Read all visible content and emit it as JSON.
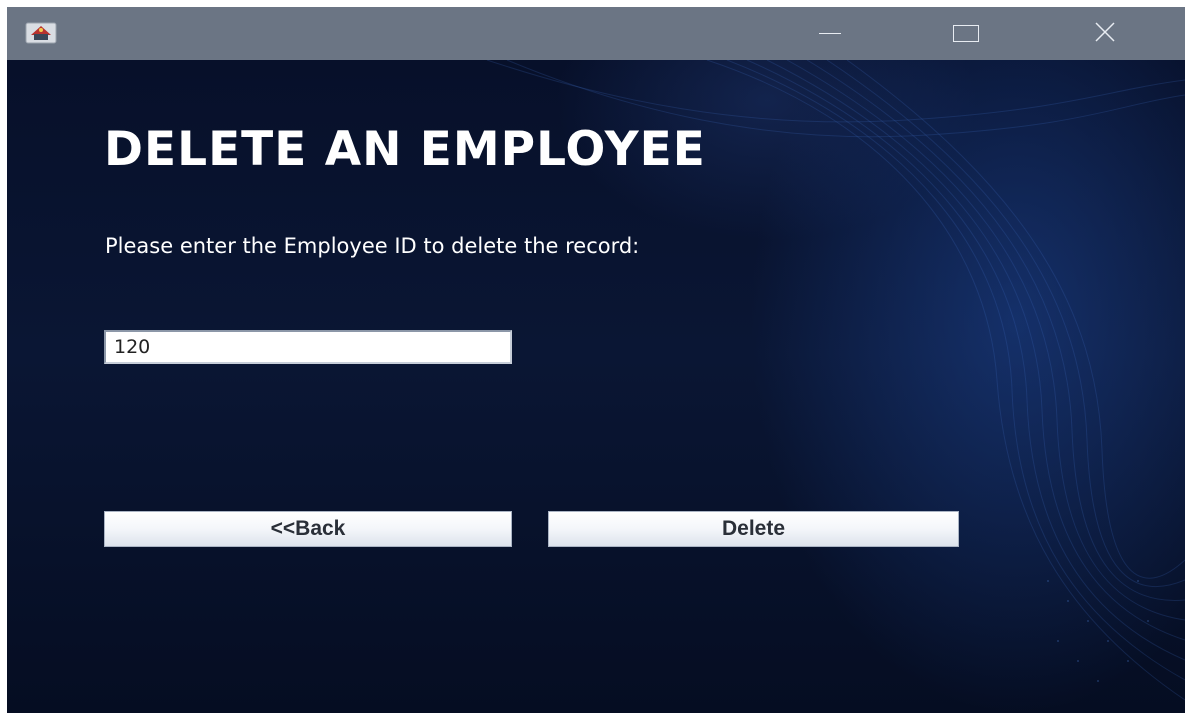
{
  "window": {
    "icon": "java-cup-icon",
    "controls": [
      "minimize-icon",
      "maximize-icon",
      "close-icon"
    ]
  },
  "form": {
    "title": "DELETE AN EMPLOYEE",
    "prompt": "Please enter the Employee ID to delete the record:",
    "employee_id_value": "120"
  },
  "buttons": {
    "back_label": "<<Back",
    "delete_label": "Delete"
  },
  "colors": {
    "titlebar": "#6b7584",
    "background": "#0b1530",
    "text": "#ffffff"
  }
}
